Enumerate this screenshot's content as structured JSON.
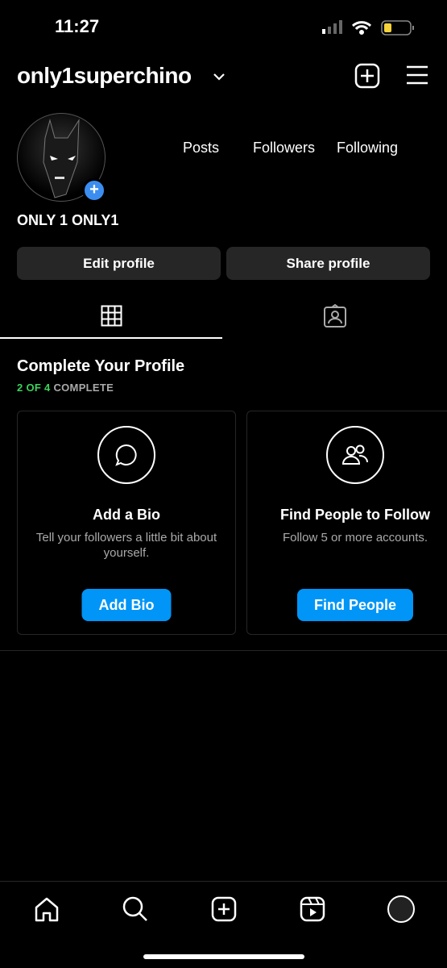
{
  "status_bar": {
    "time": "11:27",
    "battery_color": "#f5d33b"
  },
  "header": {
    "username": "only1superchino",
    "icons": [
      "chevron-down-icon",
      "new-post-icon",
      "menu-icon"
    ]
  },
  "profile": {
    "display_name": "ONLY 1 ONLY1",
    "stats": {
      "posts": "Posts",
      "followers": "Followers",
      "following": "Following"
    }
  },
  "buttons": {
    "edit": "Edit profile",
    "share": "Share profile"
  },
  "tabs": [
    "grid-icon",
    "tagged-icon"
  ],
  "complete": {
    "title": "Complete Your Profile",
    "progress": "2 OF 4",
    "progress_suffix": " COMPLETE",
    "progress_color": "#3dd35c",
    "cards": [
      {
        "title": "Add a Bio",
        "desc": "Tell your followers a little bit about yourself.",
        "button": "Add Bio",
        "icon": "speech-bubble-icon"
      },
      {
        "title": "Find People to Follow",
        "desc": "Follow 5 or more accounts.",
        "button": "Find People",
        "icon": "people-icon"
      }
    ]
  },
  "bottom_nav": [
    "home-icon",
    "search-icon",
    "create-icon",
    "reels-icon",
    "profile-avatar"
  ],
  "accent": "#0095f6"
}
